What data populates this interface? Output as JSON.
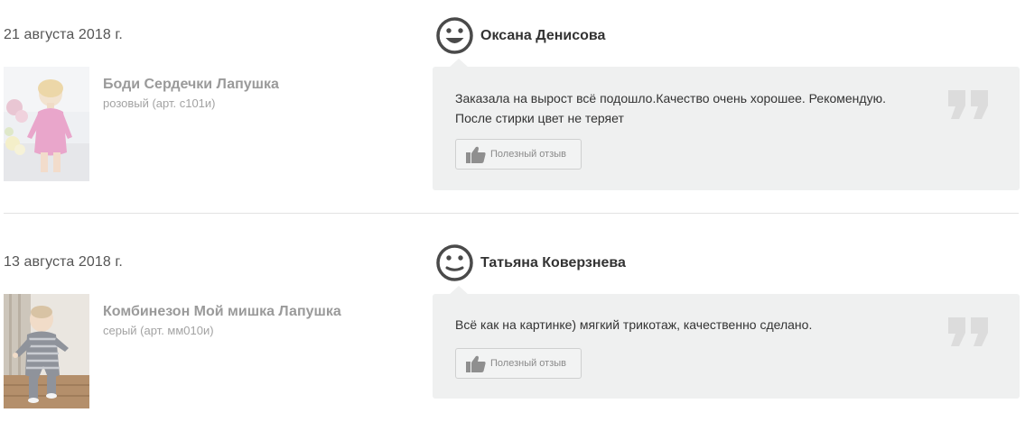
{
  "reviews": [
    {
      "date": "21 августа 2018 г.",
      "product": {
        "name": "Боди Сердечки Лапушка",
        "variant": "розовый (арт. с101и)"
      },
      "author": "Оксана Денисова",
      "text": "Заказала на вырост всё подошло.Качество очень хорошее. Рекомендую. После стирки цвет не теряет",
      "helpful_label": "Полезный отзыв",
      "mood": "happy"
    },
    {
      "date": "13 августа 2018 г.",
      "product": {
        "name": "Комбинезон Мой мишка Лапушка",
        "variant": "серый (арт. мм010и)"
      },
      "author": "Татьяна Коверзнева",
      "text": "Всё как на картинке) мягкий трикотаж, качественно сделано.",
      "helpful_label": "Полезный отзыв",
      "mood": "neutral"
    }
  ],
  "colors": {
    "bubble_bg": "#eff0f0",
    "product_name": "#9a9a9a",
    "icon_dark": "#4a4a4a",
    "quote": "#dcdcdc"
  }
}
